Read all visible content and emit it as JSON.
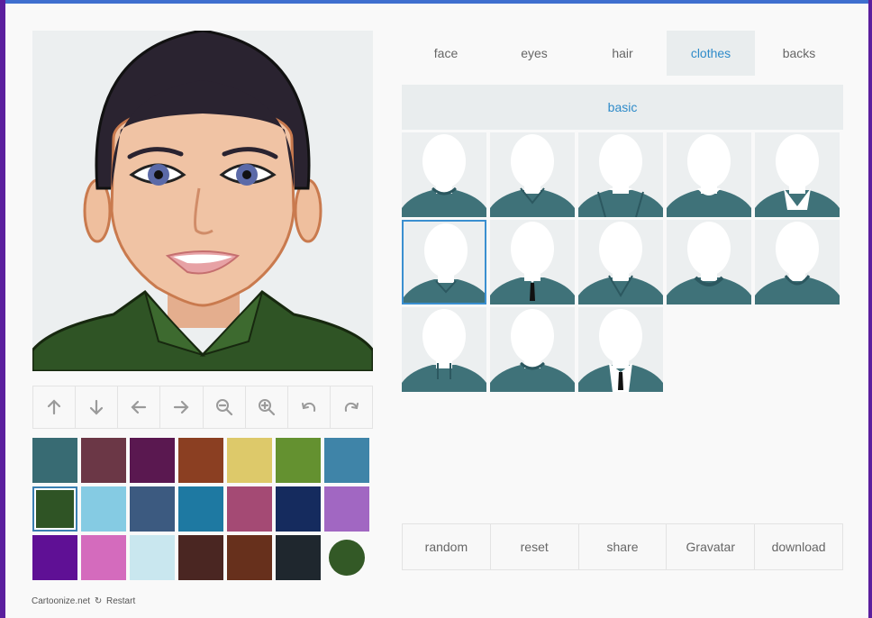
{
  "tabs": [
    {
      "label": "face"
    },
    {
      "label": "eyes"
    },
    {
      "label": "hair"
    },
    {
      "label": "clothes"
    },
    {
      "label": "backs"
    }
  ],
  "active_tab": "clothes",
  "subtab": {
    "label": "basic"
  },
  "toolbar": {
    "icons": [
      "arrow-up-icon",
      "arrow-down-icon",
      "arrow-left-icon",
      "arrow-right-icon",
      "zoom-out-icon",
      "zoom-in-icon",
      "undo-icon",
      "redo-icon"
    ]
  },
  "swatches": [
    "#386b73",
    "#6b3746",
    "#5a1850",
    "#8b3f22",
    "#ddc96a",
    "#649130",
    "#3f84a8",
    "#2f5425",
    "#85cbe3",
    "#3c5a80",
    "#1e79a2",
    "#a44a74",
    "#152b5e",
    "#a167c2",
    "#5f1095",
    "#d46bbd",
    "#c9e7ef",
    "#4a2622",
    "#67301c",
    "#1f272e",
    "#335926"
  ],
  "selected_swatch_index": 7,
  "current_color": "#335926",
  "clothes_selected_index": 5,
  "clothes_count": 13,
  "actions": {
    "random": "random",
    "reset": "reset",
    "share": "share",
    "gravatar": "Gravatar",
    "download": "download"
  },
  "footer": {
    "brand": "Cartoonize.net",
    "restart": "Restart"
  }
}
